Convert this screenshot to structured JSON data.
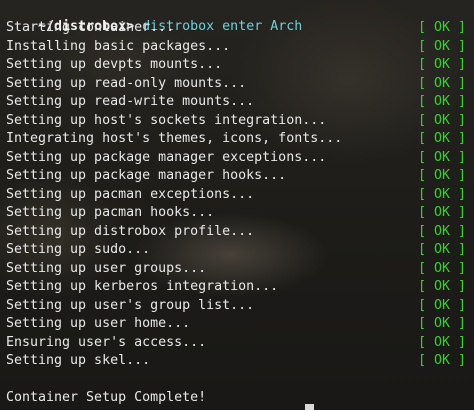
{
  "prompt": {
    "path": "~/distrobox>",
    "command": "distrobox enter Arch"
  },
  "steps": [
    {
      "text": "Starting container...",
      "status": "OK"
    },
    {
      "text": "Installing basic packages...",
      "status": "OK"
    },
    {
      "text": "Setting up devpts mounts...",
      "status": "OK"
    },
    {
      "text": "Setting up read-only mounts...",
      "status": "OK"
    },
    {
      "text": "Setting up read-write mounts...",
      "status": "OK"
    },
    {
      "text": "Setting up host's sockets integration...",
      "status": "OK"
    },
    {
      "text": "Integrating host's themes, icons, fonts...",
      "status": "OK"
    },
    {
      "text": "Setting up package manager exceptions...",
      "status": "OK"
    },
    {
      "text": "Setting up package manager hooks...",
      "status": "OK"
    },
    {
      "text": "Setting up pacman exceptions...",
      "status": "OK"
    },
    {
      "text": "Setting up pacman hooks...",
      "status": "OK"
    },
    {
      "text": "Setting up distrobox profile...",
      "status": "OK"
    },
    {
      "text": "Setting up sudo...",
      "status": "OK"
    },
    {
      "text": "Setting up user groups...",
      "status": "OK"
    },
    {
      "text": "Setting up kerberos integration...",
      "status": "OK"
    },
    {
      "text": "Setting up user's group list...",
      "status": "OK"
    },
    {
      "text": "Setting up user home...",
      "status": "OK"
    },
    {
      "text": "Ensuring user's access...",
      "status": "OK"
    },
    {
      "text": "Setting up skel...",
      "status": "OK"
    }
  ],
  "completion_message": "Container Setup Complete!",
  "colors": {
    "ok_green": "#35d22e",
    "command_cyan": "#6fd0d8",
    "text": "#e9e9e9"
  }
}
